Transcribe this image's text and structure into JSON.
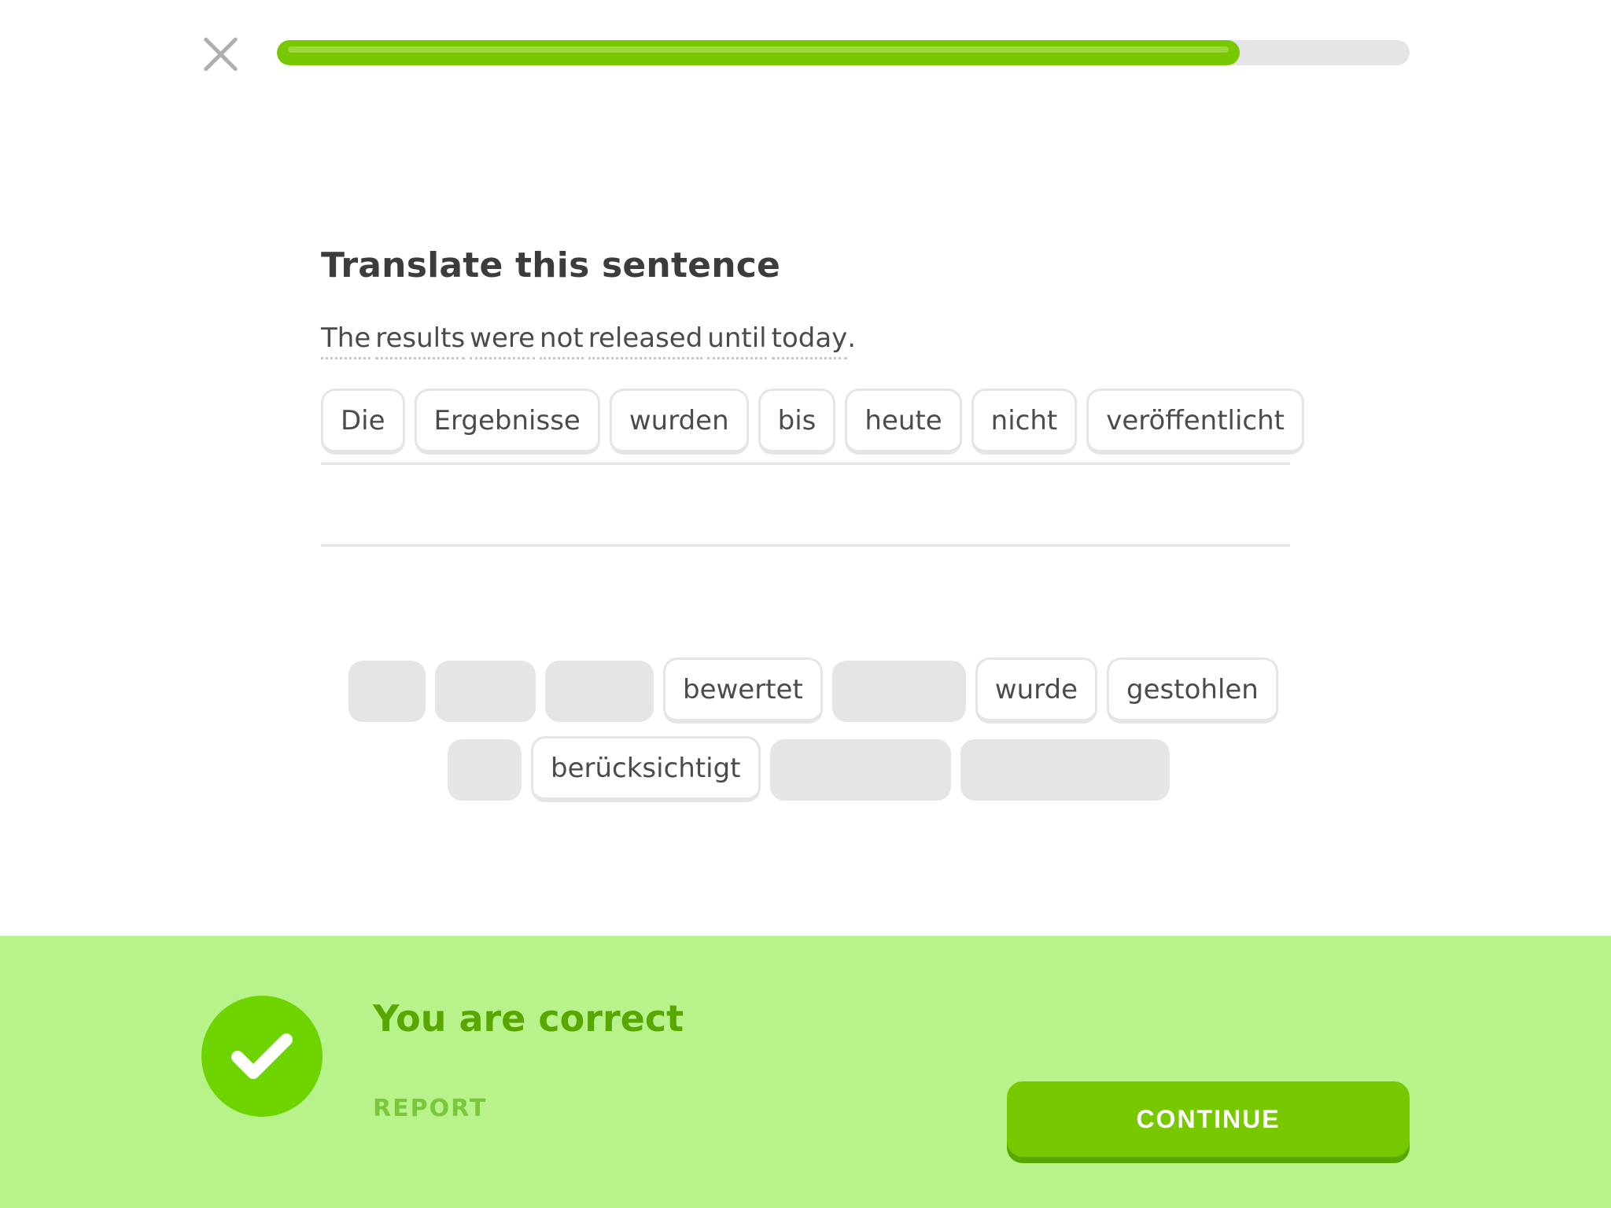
{
  "header": {
    "close_icon": "close-icon",
    "progress_fraction": 0.85
  },
  "prompt": {
    "title": "Translate this sentence",
    "source_words": [
      "The",
      "results",
      "were",
      "not",
      "released",
      "until",
      "today"
    ],
    "source_punct": "."
  },
  "answer": {
    "tiles": [
      "Die",
      "Ergebnisse",
      "wurden",
      "bis",
      "heute",
      "nicht",
      "veröffentlicht"
    ]
  },
  "word_bank": {
    "row1": [
      {
        "type": "empty"
      },
      {
        "type": "empty"
      },
      {
        "type": "empty"
      },
      {
        "type": "word",
        "label": "bewertet"
      },
      {
        "type": "empty"
      },
      {
        "type": "word",
        "label": "wurde"
      },
      {
        "type": "word",
        "label": "gestohlen"
      }
    ],
    "row2": [
      {
        "type": "empty"
      },
      {
        "type": "word",
        "label": "berücksichtigt"
      },
      {
        "type": "empty"
      },
      {
        "type": "empty"
      }
    ]
  },
  "feedback": {
    "title": "You are correct",
    "report_label": "REPORT",
    "continue_label": "CONTINUE",
    "status_icon": "checkmark-icon",
    "colors": {
      "background": "#b8f28b",
      "accent": "#58a700",
      "button": "#78c800"
    }
  }
}
